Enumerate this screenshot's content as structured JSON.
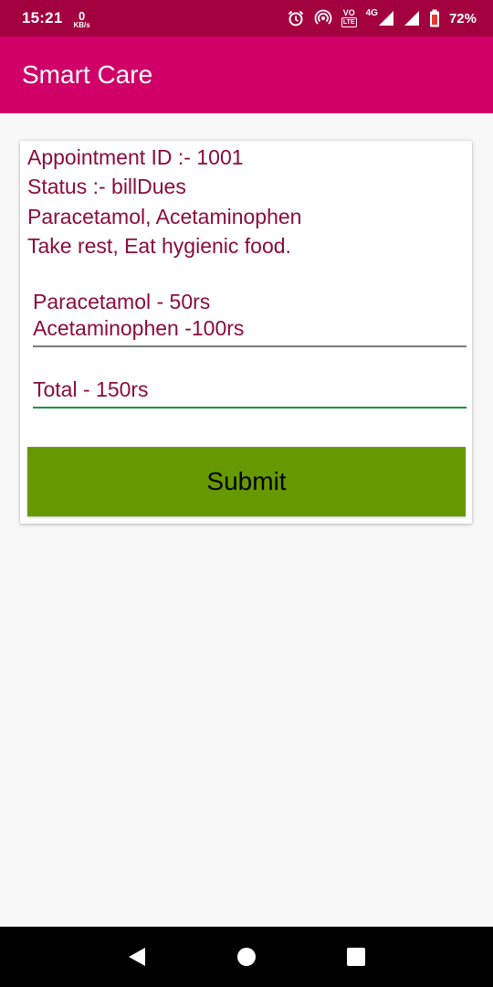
{
  "status_bar": {
    "time": "15:21",
    "net_speed_value": "0",
    "net_speed_unit": "KB/s",
    "lte_label": "LTE",
    "vo_label": "VO",
    "network_type": "4G",
    "battery_percent": "72%",
    "icons": [
      "alarm-icon",
      "hotspot-icon",
      "volte-icon",
      "signal-icon",
      "battery-icon"
    ]
  },
  "app_bar": {
    "title": "Smart Care",
    "color": "#d00068"
  },
  "card": {
    "appointment_id": "Appointment ID :- 1001",
    "status": "Status :- billDues",
    "medicines": "Paracetamol, Acetaminophen",
    "advice": "Take rest, Eat hygienic food.",
    "medicine_prices": [
      "Paracetamol - 50rs",
      "Acetaminophen -100rs"
    ],
    "total": "Total - 150rs",
    "submit_label": "Submit",
    "text_color": "#8a0d3b",
    "button_color": "#669900"
  },
  "nav_bar": {
    "icons": [
      "back-icon",
      "home-icon",
      "recents-icon"
    ]
  }
}
